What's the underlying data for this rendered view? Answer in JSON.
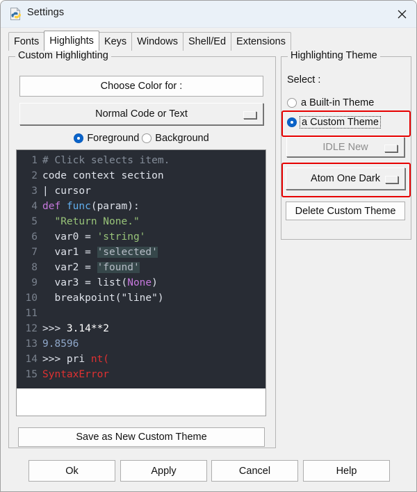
{
  "window": {
    "title": "Settings",
    "icon": "python-file-icon",
    "close_icon": "close-icon"
  },
  "tabs": [
    {
      "label": "Fonts",
      "active": false
    },
    {
      "label": "Highlights",
      "active": true
    },
    {
      "label": "Keys",
      "active": false
    },
    {
      "label": "Windows",
      "active": false
    },
    {
      "label": "Shell/Ed",
      "active": false
    },
    {
      "label": "Extensions",
      "active": false
    }
  ],
  "custom_highlighting": {
    "frame_title": "Custom Highlighting",
    "choose_color_label": "Choose Color for :",
    "element_option": "Normal Code or Text",
    "fg_label": "Foreground",
    "bg_label": "Background",
    "fg_selected": true,
    "bg_selected": false,
    "save_button": "Save as New Custom Theme"
  },
  "highlighting_theme": {
    "frame_title": "Highlighting Theme",
    "select_label": "Select :",
    "builtin_label": "a Built-in Theme",
    "custom_label": "a Custom Theme",
    "builtin_selected": false,
    "custom_selected": true,
    "builtin_option": "IDLE New",
    "builtin_option_disabled": true,
    "custom_option": "Atom One Dark",
    "delete_button": "Delete Custom Theme"
  },
  "code_sample": {
    "background": "#282c34",
    "linenumber_color": "#7a828e",
    "lines": [
      {
        "no": "1",
        "spans": [
          {
            "t": "# Click selects item.",
            "c": "#848d99"
          }
        ]
      },
      {
        "no": "2",
        "spans": [
          {
            "t": "code context section",
            "c": "#dfe3eb"
          }
        ]
      },
      {
        "no": "3",
        "spans": [
          {
            "t": "| cursor",
            "c": "#dfe3eb"
          }
        ]
      },
      {
        "no": "4",
        "spans": [
          {
            "t": "def ",
            "c": "#c678dd"
          },
          {
            "t": "func",
            "c": "#61afef"
          },
          {
            "t": "(param):",
            "c": "#dfe3eb"
          }
        ]
      },
      {
        "no": "5",
        "spans": [
          {
            "t": "  ",
            "c": "#dfe3eb"
          },
          {
            "t": "\"Return None.\"",
            "c": "#98c379"
          }
        ]
      },
      {
        "no": "6",
        "spans": [
          {
            "t": "  var0 = ",
            "c": "#dfe3eb"
          },
          {
            "t": "'string'",
            "c": "#98c379"
          }
        ]
      },
      {
        "no": "7",
        "spans": [
          {
            "t": "  var1 = ",
            "c": "#dfe3eb"
          },
          {
            "t": "'selected'",
            "c": "#b6bcc6",
            "bg": "#36474a"
          }
        ]
      },
      {
        "no": "8",
        "spans": [
          {
            "t": "  var2 = ",
            "c": "#dfe3eb"
          },
          {
            "t": "'found'",
            "c": "#b6bcc6",
            "bg": "#36474a"
          }
        ]
      },
      {
        "no": "9",
        "spans": [
          {
            "t": "  var3 = list(",
            "c": "#dfe3eb"
          },
          {
            "t": "None",
            "c": "#c678dd"
          },
          {
            "t": ")",
            "c": "#dfe3eb"
          }
        ]
      },
      {
        "no": "10",
        "spans": [
          {
            "t": "  breakpoint(\"line\")",
            "c": "#dfe3eb"
          }
        ]
      },
      {
        "no": "11",
        "spans": [
          {
            "t": "",
            "c": "#dfe3eb"
          }
        ]
      },
      {
        "no": "12",
        "spans": [
          {
            "t": ">>> ",
            "c": "#dfe3eb"
          },
          {
            "t": "3.14**2",
            "c": "#ffffff"
          }
        ]
      },
      {
        "no": "13",
        "spans": [
          {
            "t": "9.8596",
            "c": "#8fa7c9"
          }
        ]
      },
      {
        "no": "14",
        "spans": [
          {
            "t": ">>> pri ",
            "c": "#dfe3eb"
          },
          {
            "t": "nt(",
            "c": "#e03131"
          }
        ]
      },
      {
        "no": "15",
        "spans": [
          {
            "t": "SyntaxError",
            "c": "#e03131"
          }
        ]
      }
    ]
  },
  "annotations": {
    "color": "#e60000",
    "boxes": [
      "a Custom Theme",
      "Atom One Dark"
    ]
  },
  "actions": [
    {
      "label": "Ok"
    },
    {
      "label": "Apply"
    },
    {
      "label": "Cancel"
    },
    {
      "label": "Help"
    }
  ]
}
